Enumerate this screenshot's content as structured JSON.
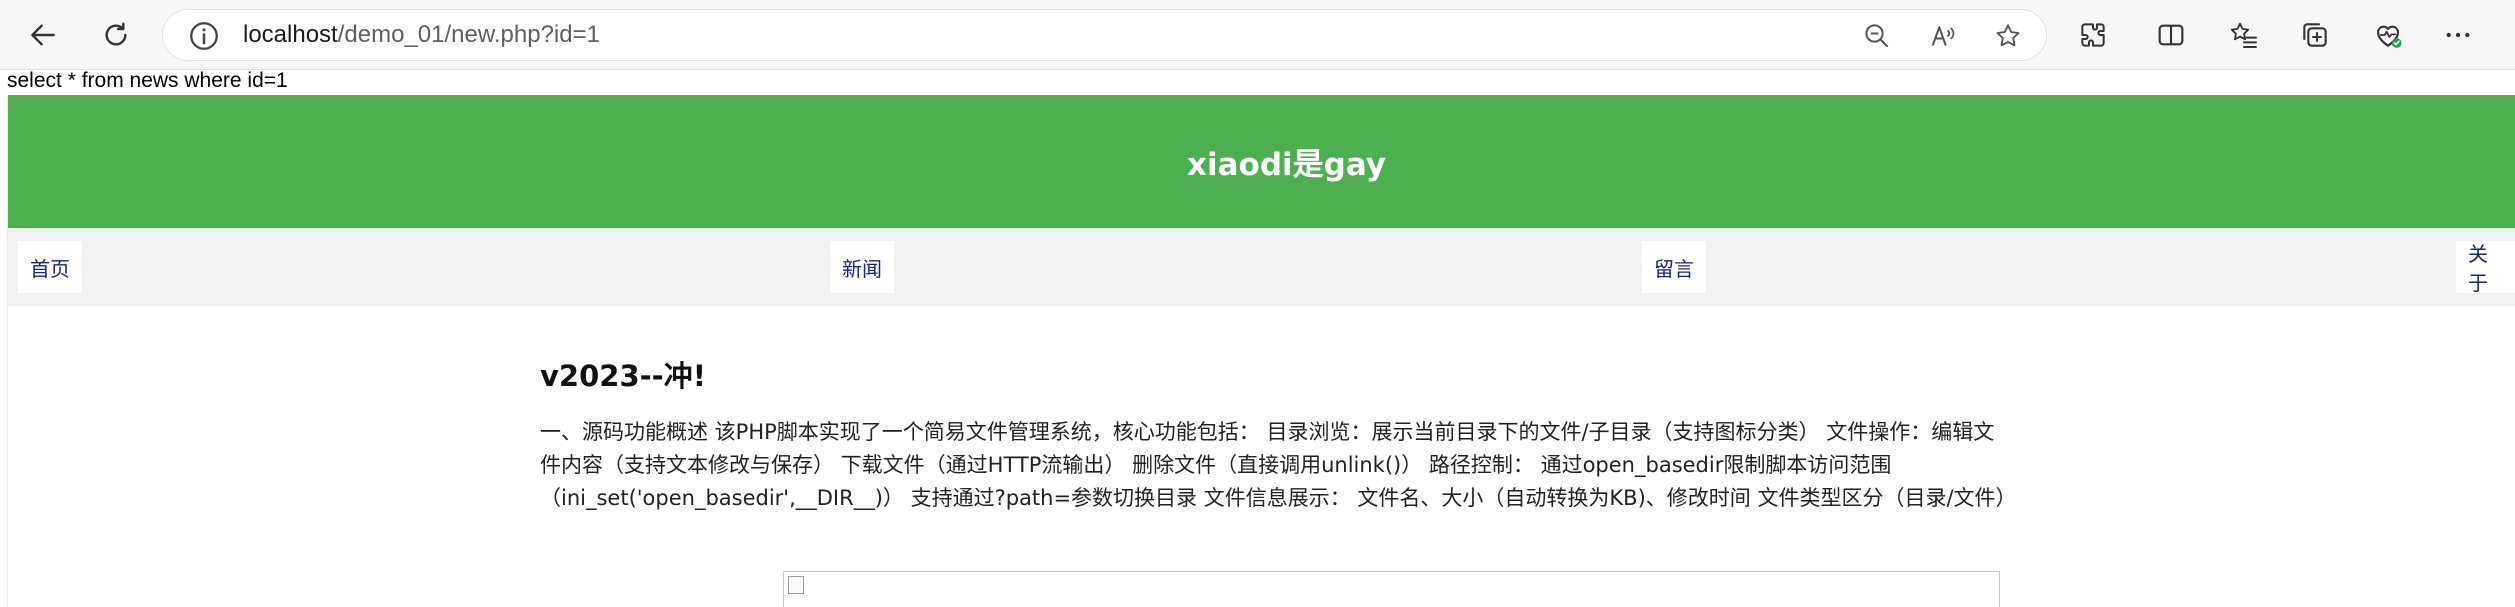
{
  "browser": {
    "url_host": "localhost",
    "url_path": "/demo_01/new.php?id=1",
    "icons": [
      "back-icon",
      "refresh-icon",
      "info-icon",
      "zoom-out-icon",
      "read-aloud-icon",
      "favorite-star-icon",
      "extensions-icon",
      "split-screen-icon",
      "favorites-icon",
      "collections-icon",
      "browser-essentials-icon",
      "more-icon"
    ]
  },
  "page": {
    "sql_query": "select * from news where id=1",
    "banner_title": "xiaodi是gay",
    "nav": {
      "home": "首页",
      "news": "新闻",
      "guestbook": "留言",
      "about": "关于"
    },
    "article": {
      "title": "v2023--冲!",
      "body": "一、源码功能概述 该PHP脚本实现了一个简易文件管理系统，核心功能包括： 目录浏览：展示当前目录下的文件/子目录（支持图标分类） 文件操作：编辑文件内容（支持文本修改与保存） 下载文件（通过HTTP流输出） 删除文件（直接调用unlink()） 路径控制： 通过open_basedir限制脚本访问范围（ini_set('open_basedir',__DIR__)） 支持通过?path=参数切换目录 文件信息展示： 文件名、大小（自动转换为KB)、修改时间 文件类型区分（目录/文件）"
    }
  },
  "colors": {
    "banner": "#4caf50",
    "nav_bg": "#f1f1f1",
    "nav_text": "#1a237e",
    "chrome_bg": "#f7f7f7"
  }
}
